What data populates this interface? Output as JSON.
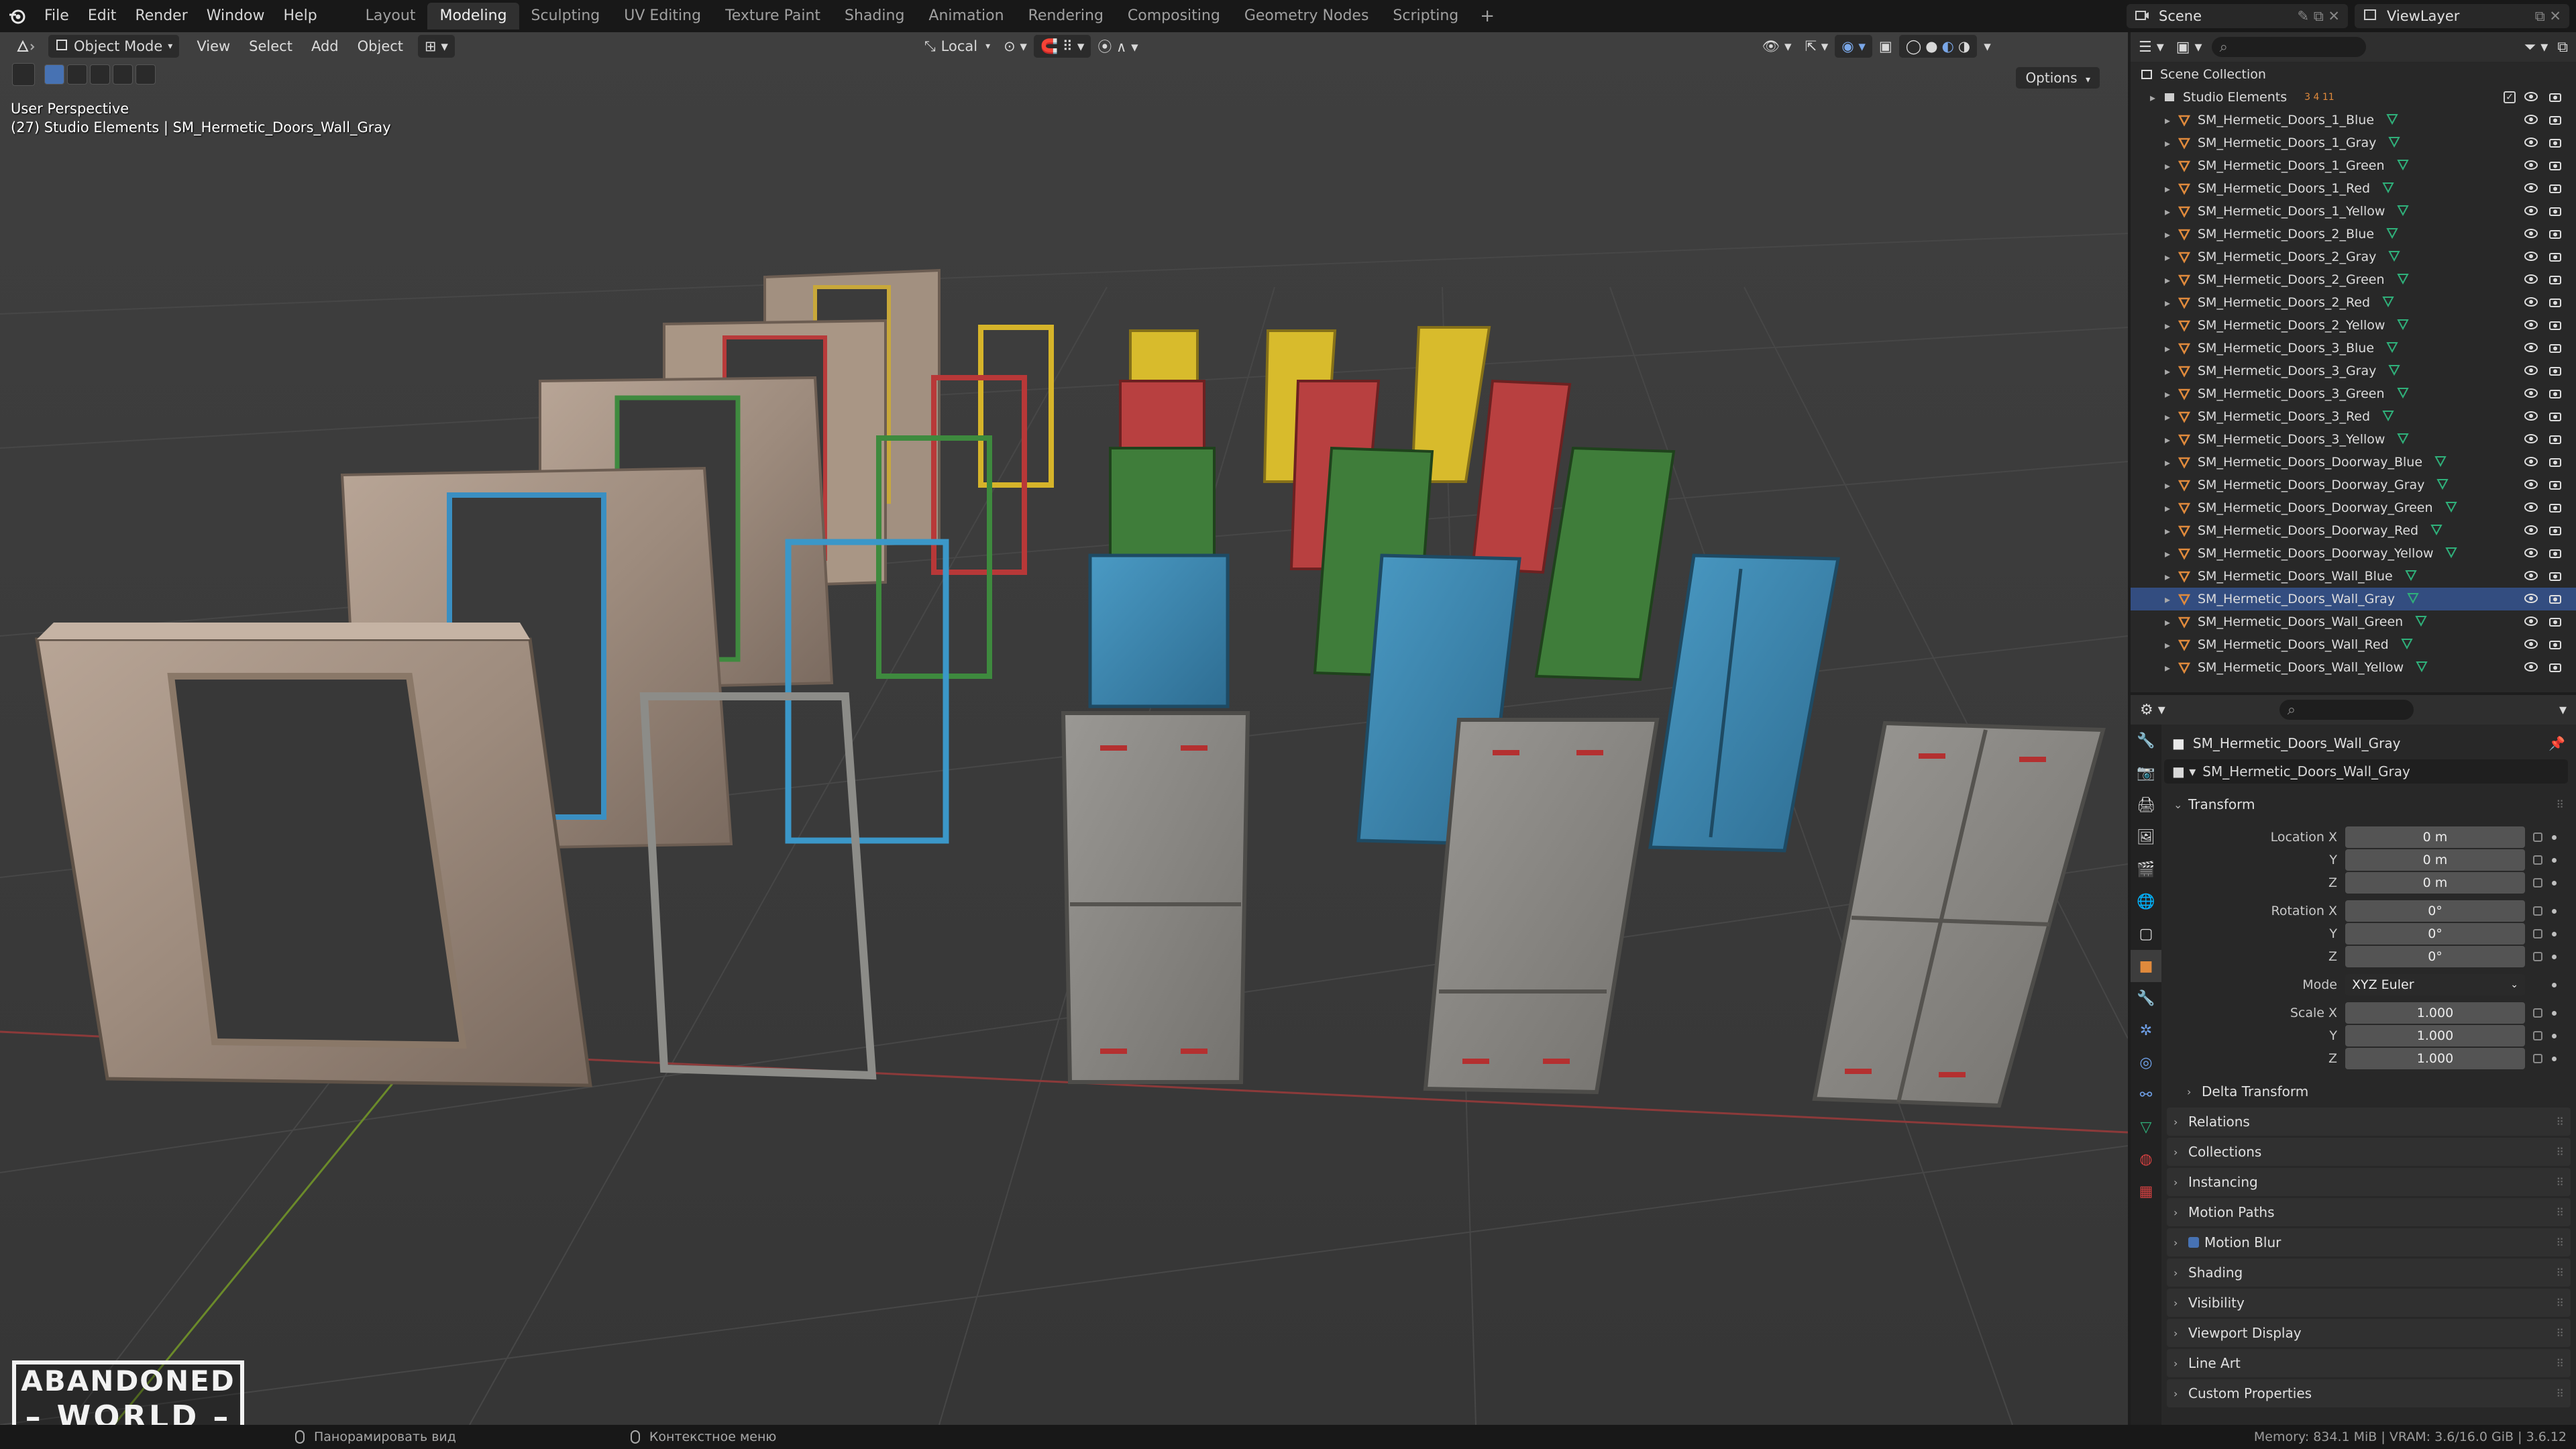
{
  "menubar": {
    "items": [
      "File",
      "Edit",
      "Render",
      "Window",
      "Help"
    ],
    "workspaces": [
      "Layout",
      "Modeling",
      "Sculpting",
      "UV Editing",
      "Texture Paint",
      "Shading",
      "Animation",
      "Rendering",
      "Compositing",
      "Geometry Nodes",
      "Scripting"
    ],
    "active_workspace": "Modeling",
    "add_tab": "+",
    "scene": "Scene",
    "view_layer": "ViewLayer"
  },
  "viewport": {
    "mode": "Object Mode",
    "menus": [
      "View",
      "Select",
      "Add",
      "Object"
    ],
    "orientation": "Local",
    "options": "Options",
    "perspective": "User Perspective",
    "active_info": "(27) Studio Elements | SM_Hermetic_Doors_Wall_Gray",
    "logo_line1": "ABANDONED",
    "logo_line2": "WORLD"
  },
  "outliner": {
    "root": "Scene Collection",
    "collection": "Studio Elements",
    "collection_badges": "3 4 11",
    "objects": [
      "SM_Hermetic_Doors_1_Blue",
      "SM_Hermetic_Doors_1_Gray",
      "SM_Hermetic_Doors_1_Green",
      "SM_Hermetic_Doors_1_Red",
      "SM_Hermetic_Doors_1_Yellow",
      "SM_Hermetic_Doors_2_Blue",
      "SM_Hermetic_Doors_2_Gray",
      "SM_Hermetic_Doors_2_Green",
      "SM_Hermetic_Doors_2_Red",
      "SM_Hermetic_Doors_2_Yellow",
      "SM_Hermetic_Doors_3_Blue",
      "SM_Hermetic_Doors_3_Gray",
      "SM_Hermetic_Doors_3_Green",
      "SM_Hermetic_Doors_3_Red",
      "SM_Hermetic_Doors_3_Yellow",
      "SM_Hermetic_Doors_Doorway_Blue",
      "SM_Hermetic_Doors_Doorway_Gray",
      "SM_Hermetic_Doors_Doorway_Green",
      "SM_Hermetic_Doors_Doorway_Red",
      "SM_Hermetic_Doors_Doorway_Yellow",
      "SM_Hermetic_Doors_Wall_Blue",
      "SM_Hermetic_Doors_Wall_Gray",
      "SM_Hermetic_Doors_Wall_Green",
      "SM_Hermetic_Doors_Wall_Red",
      "SM_Hermetic_Doors_Wall_Yellow"
    ],
    "selected_object": "SM_Hermetic_Doors_Wall_Gray"
  },
  "properties": {
    "object_name": "SM_Hermetic_Doors_Wall_Gray",
    "object_field": "SM_Hermetic_Doors_Wall_Gray",
    "transform_label": "Transform",
    "location_label": "Location X",
    "rotation_label": "Rotation X",
    "scale_label": "Scale X",
    "axis_y": "Y",
    "axis_z": "Z",
    "location": [
      "0 m",
      "0 m",
      "0 m"
    ],
    "rotation": [
      "0°",
      "0°",
      "0°"
    ],
    "mode_label": "Mode",
    "mode_value": "XYZ Euler",
    "scale": [
      "1.000",
      "1.000",
      "1.000"
    ],
    "delta_transform": "Delta Transform",
    "panels": [
      "Relations",
      "Collections",
      "Instancing",
      "Motion Paths",
      "Motion Blur",
      "Shading",
      "Visibility",
      "Viewport Display",
      "Line Art",
      "Custom Properties"
    ]
  },
  "statusbar": {
    "hint_pan": "Панорамировать вид",
    "hint_context": "Контекстное меню",
    "memory": "Memory: 834.1 MiB | VRAM: 3.6/16.0 GiB | 3.6.12"
  },
  "colors": {
    "accent": "#4772b3",
    "selection": "#334d80",
    "mesh_icon": "#2fb07a",
    "object_icon": "#e08a3c",
    "x_axis": "#8c3a3a",
    "y_axis": "#6b8a2a"
  }
}
